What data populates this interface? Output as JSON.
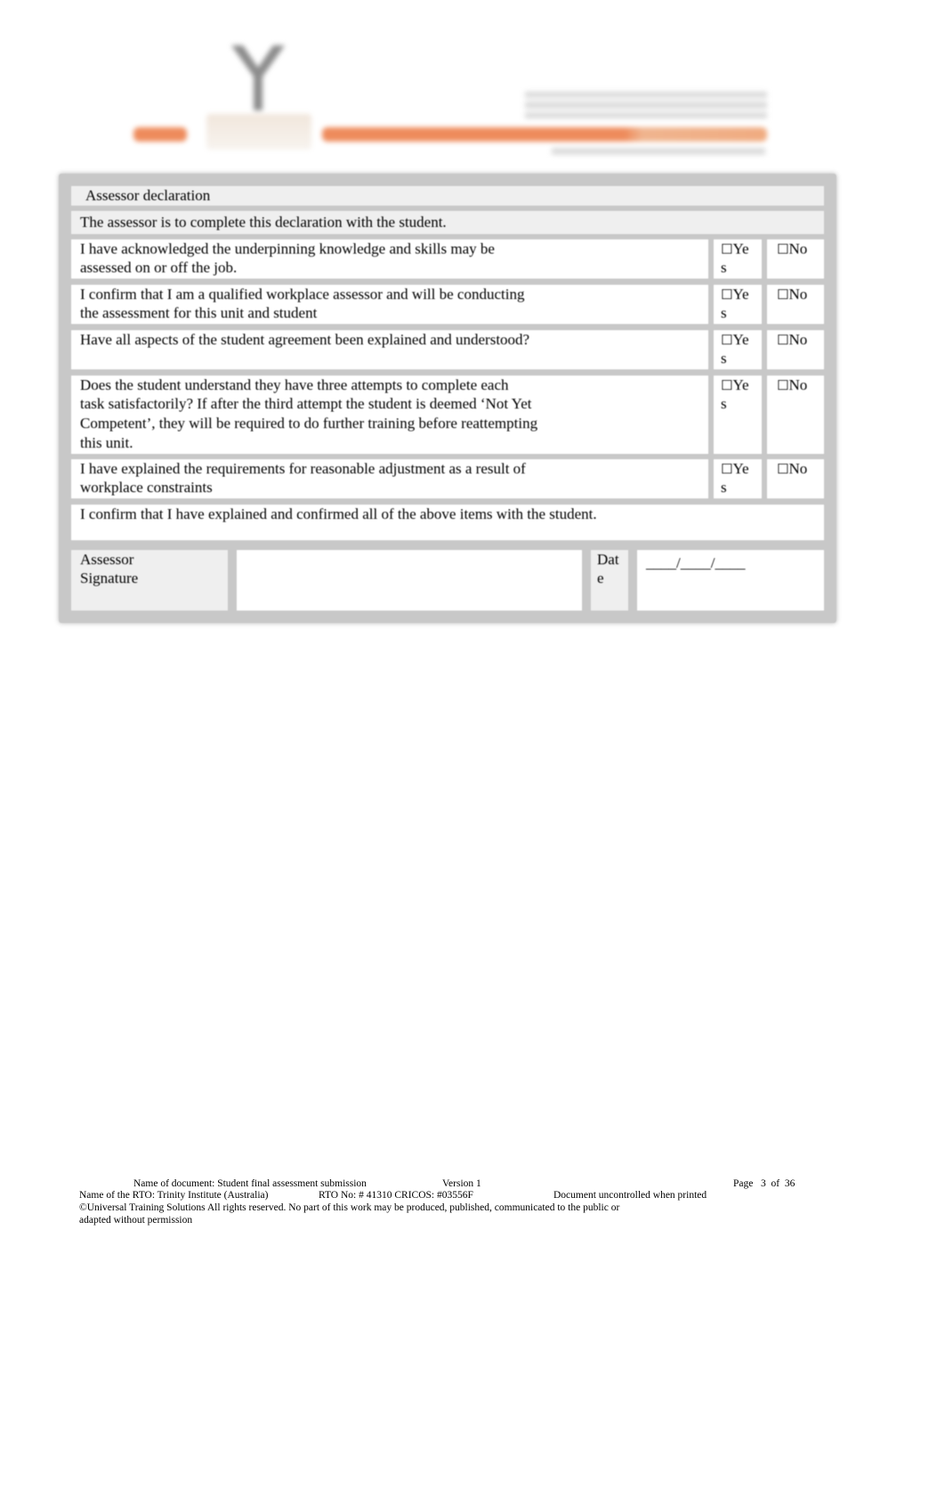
{
  "header": {
    "logo_icon": "trinity-institute-logo",
    "brand_color": "#ee8b5c"
  },
  "table": {
    "title": "Assessor declaration",
    "intro": "The assessor is to complete this declaration with the student.",
    "items": [
      {
        "line1": "I have acknowledged the underpinning knowledge and skills may be",
        "line2": "assessed on or off the job.",
        "line3": "",
        "line4": "",
        "yes": "Ye",
        "yes_wrap": "s",
        "no": "No"
      },
      {
        "line1": "I confirm that I am a qualified workplace assessor and will be conducting",
        "line2": "the assessment for this unit and student",
        "line3": "",
        "line4": "",
        "yes": "Ye",
        "yes_wrap": "s",
        "no": "No"
      },
      {
        "line1": "Have all aspects of the student agreement been explained and understood?",
        "line2": "",
        "line3": "",
        "line4": "",
        "yes": "Ye",
        "yes_wrap": "s",
        "no": "No"
      },
      {
        "line1": "Does the student understand they have three attempts to complete each",
        "line2": "task satisfactorily? If after the third attempt the student is deemed ‘Not Yet",
        "line3": "Competent’, they will be required to do further training before reattempting",
        "line4": "this unit.",
        "yes": "Ye",
        "yes_wrap": "s",
        "no": "No"
      },
      {
        "line1": "I have explained the requirements for reasonable adjustment as a result of",
        "line2": "workplace constraints",
        "line3": "",
        "line4": "",
        "yes": "Ye",
        "yes_wrap": "s",
        "no": "No"
      }
    ],
    "checkbox_glyph": "☐",
    "confirm": "I confirm that I have explained and confirmed all of the above items with the student.",
    "signature_label_1": "Assessor",
    "signature_label_2": "Signature",
    "signature_value": "",
    "date_label_1": "Dat",
    "date_label_2": "e",
    "date_value": "____/____/____"
  },
  "footer": {
    "doc_name": "Name of document: Student final assessment submission",
    "version": "Version 1",
    "page_label": "Page",
    "page_current": "3",
    "page_of": "of",
    "page_total": "36",
    "rto_name": "Name of the RTO: Trinity Institute (Australia)",
    "rto_no": "RTO No: # 41310 CRICOS: #03556F",
    "uncontrolled": "Document uncontrolled when printed",
    "copyright_1": "©Universal Training Solutions All rights reserved. No part of this work may be produced, published, communicated to the public or",
    "copyright_2": "adapted without permission"
  }
}
